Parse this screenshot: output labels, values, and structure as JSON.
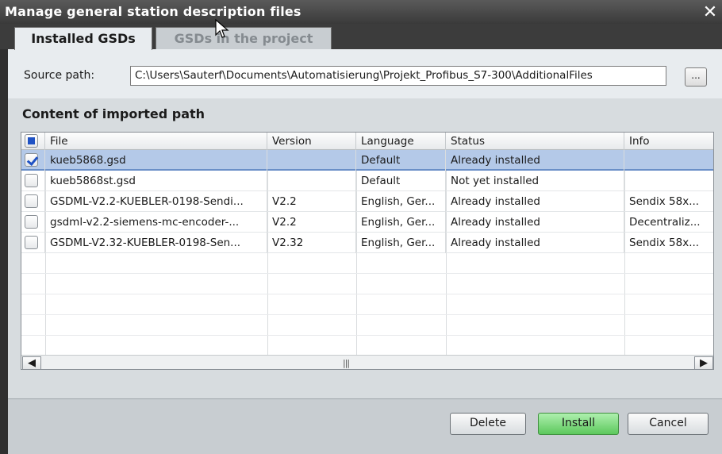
{
  "window": {
    "title": "Manage general station description files"
  },
  "tabs": [
    {
      "label": "Installed GSDs",
      "active": true
    },
    {
      "label": "GSDs in the project",
      "active": false
    }
  ],
  "source": {
    "label": "Source path:",
    "path": "C:\\Users\\Sauterf\\Documents\\Automatisierung\\Projekt_Profibus_S7-300\\AdditionalFiles",
    "browse_label": "..."
  },
  "section": {
    "title": "Content of imported path"
  },
  "table": {
    "columns": [
      "File",
      "Version",
      "Language",
      "Status",
      "Info"
    ],
    "rows": [
      {
        "checked": true,
        "file": "kueb5868.gsd",
        "version": "",
        "language": "Default",
        "status": "Already installed",
        "info": ""
      },
      {
        "checked": false,
        "file": "kueb5868st.gsd",
        "version": "",
        "language": "Default",
        "status": "Not yet installed",
        "info": ""
      },
      {
        "checked": false,
        "file": "GSDML-V2.2-KUEBLER-0198-Sendi...",
        "version": "V2.2",
        "language": "English, Ger...",
        "status": "Already installed",
        "info": "Sendix 58x..."
      },
      {
        "checked": false,
        "file": "gsdml-v2.2-siemens-mc-encoder-...",
        "version": "V2.2",
        "language": "English, Ger...",
        "status": "Already installed",
        "info": "Decentraliz..."
      },
      {
        "checked": false,
        "file": "GSDML-V2.32-KUEBLER-0198-Sen...",
        "version": "V2.32",
        "language": "English, Ger...",
        "status": "Already installed",
        "info": "Sendix 58x..."
      }
    ]
  },
  "scrollbar": {
    "grip": "|||"
  },
  "buttons": {
    "delete": "Delete",
    "install": "Install",
    "cancel": "Cancel"
  },
  "colors": {
    "selection": "#b4c9e8",
    "install_green": "#5cc85c",
    "titlebar": "#3a3a3a"
  }
}
